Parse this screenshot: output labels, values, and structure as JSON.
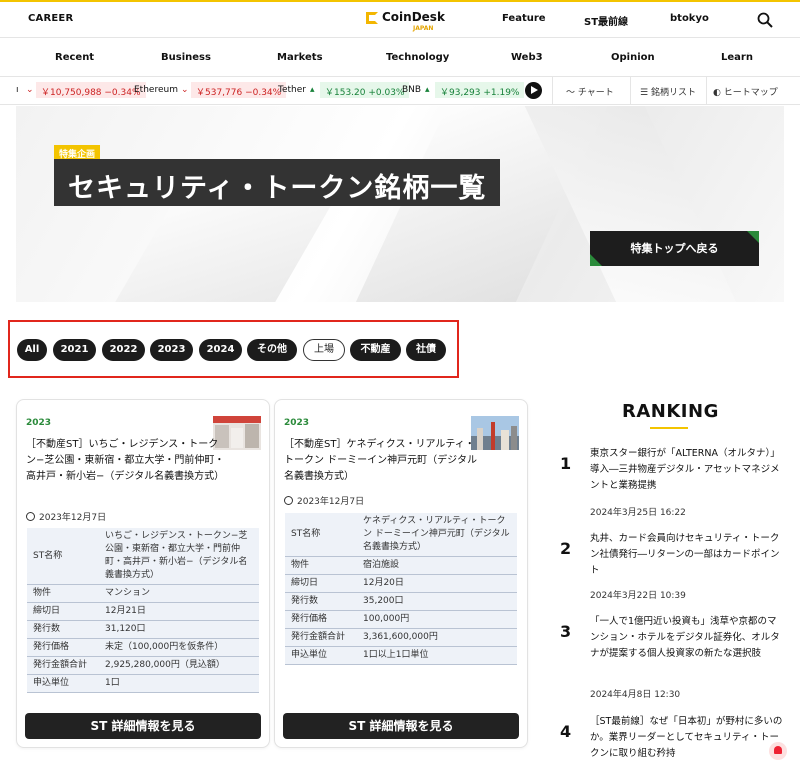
{
  "header": {
    "career": "CAREER",
    "logo_name": "CoinDesk",
    "logo_sub": "JAPAN",
    "feature": "Feature",
    "st_latest": "ST最前線",
    "btokyo": "btokyo"
  },
  "nav": {
    "items": [
      "Recent",
      "Business",
      "Markets",
      "Technology",
      "Web3",
      "Opinion",
      "Learn"
    ]
  },
  "ticker": {
    "btc_price": "￥10,750,988 −0.34%",
    "eth_name": "Ethereum",
    "eth_price": "￥537,776 −0.34%",
    "tether_name": "Tether",
    "tether_price": "￥153.20 +0.03%",
    "bnb_name": "BNB",
    "bnb_price": "￥93,293 +1.19%",
    "tools": [
      "チャート",
      "銘柄リスト",
      "ヒートマップ"
    ]
  },
  "hero": {
    "tag": "特集企画",
    "title": "セキュリティ・トークン銘柄一覧",
    "back_button": "特集トップへ戻る"
  },
  "filters": [
    "All",
    "2021",
    "2022",
    "2023",
    "2024",
    "その他",
    "上場",
    "不動産",
    "社債"
  ],
  "cards": [
    {
      "year": "2023",
      "title": "［不動産ST］いちご・レジデンス・トークン−芝公園・東新宿・都立大学・門前仲町・高井戸・新小岩−（デジタル名義書換方式）",
      "date": "2023年12月7日",
      "rows": [
        {
          "k": "ST名称",
          "v": "いちご・レジデンス・トークン−芝公園・東新宿・都立大学・門前仲町・高井戸・新小岩−（デジタル名義書換方式）"
        },
        {
          "k": "物件",
          "v": "マンション"
        },
        {
          "k": "締切日",
          "v": "12月21日"
        },
        {
          "k": "発行数",
          "v": "31,120口"
        },
        {
          "k": "発行価格",
          "v": "未定（100,000円を仮条件）"
        },
        {
          "k": "発行金額合計",
          "v": "2,925,280,000円（見込額）"
        },
        {
          "k": "申込単位",
          "v": "1口"
        }
      ],
      "button": "ST 詳細情報を見る"
    },
    {
      "year": "2023",
      "title": "［不動産ST］ケネディクス・リアルティ・トークン ドーミーイン神戸元町（デジタル名義書換方式）",
      "date": "2023年12月7日",
      "rows": [
        {
          "k": "ST名称",
          "v": "ケネディクス・リアルティ・トークン ドーミーイン神戸元町（デジタル名義書換方式）"
        },
        {
          "k": "物件",
          "v": "宿泊施設"
        },
        {
          "k": "締切日",
          "v": "12月20日"
        },
        {
          "k": "発行数",
          "v": "35,200口"
        },
        {
          "k": "発行価格",
          "v": "100,000円"
        },
        {
          "k": "発行金額合計",
          "v": "3,361,600,000円"
        },
        {
          "k": "申込単位",
          "v": "1口以上1口単位"
        }
      ],
      "button": "ST 詳細情報を見る"
    }
  ],
  "ranking": {
    "heading": "RANKING",
    "items": [
      {
        "num": "1",
        "text": "東京スター銀行が「ALTERNA（オルタナ）」導入―三井物産デジタル・アセットマネジメントと業務提携",
        "date": "2024年3月25日 16:22"
      },
      {
        "num": "2",
        "text": "丸井、カード会員向けセキュリティ・トークン社債発行―リターンの一部はカードポイント",
        "date": "2024年3月22日 10:39"
      },
      {
        "num": "3",
        "text": "「一人で1億円近い投資も」浅草や京都のマンション・ホテルをデジタル証券化、オルタナが提案する個人投資家の新たな選択肢",
        "date": "2024年4月8日 12:30"
      },
      {
        "num": "4",
        "text": "［ST最前線］なぜ「日本初」が野村に多いのか。業界リーダーとしてセキュリティ・トークンに取り組む矜持",
        "date": ""
      }
    ]
  }
}
